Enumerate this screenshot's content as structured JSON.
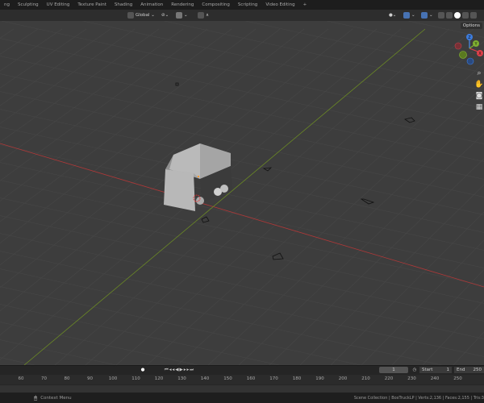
{
  "workspace_tabs": [
    "ng",
    "Sculpting",
    "UV Editing",
    "Texture Paint",
    "Shading",
    "Animation",
    "Rendering",
    "Compositing",
    "Scripting",
    "Video Editing",
    "+"
  ],
  "header": {
    "orientation": "Global",
    "options": "Options"
  },
  "gizmo": {
    "x": "X",
    "y": "Y",
    "z": "Z"
  },
  "timeline": {
    "current_frame": "1",
    "start_label": "Start",
    "start": "1",
    "end_label": "End",
    "end": "250",
    "ruler": [
      "60",
      "70",
      "80",
      "90",
      "100",
      "110",
      "120",
      "130",
      "140",
      "150",
      "160",
      "170",
      "180",
      "190",
      "200",
      "210",
      "220",
      "230",
      "240",
      "250"
    ]
  },
  "status": {
    "context_menu": "Context Menu",
    "info": "Scene Collection | BoxTruckLP | Verts:2,136 | Faces:2,155 | Tris:3"
  },
  "colors": {
    "x_axis": "#b03838",
    "y_axis": "#6b8a24",
    "accent": "#4772b3"
  }
}
